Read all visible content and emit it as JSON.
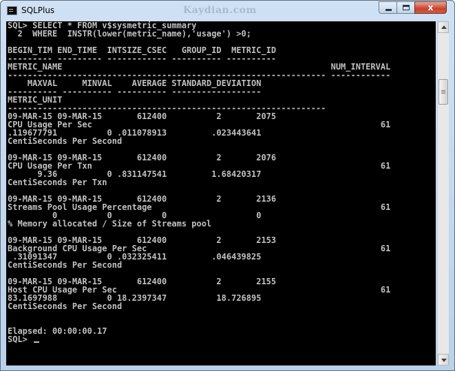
{
  "window": {
    "title": "SQLPlus",
    "watermark": "Kaydian.com"
  },
  "icons": {
    "app": "sqlplus-console-icon",
    "minimize": "minimize-icon",
    "maximize": "maximize-icon",
    "close": "close-icon"
  },
  "controls": {
    "close_glyph": "x"
  },
  "console": {
    "lines": [
      "SQL> SELECT * FROM v$sysmetric_summary",
      "  2  WHERE  INSTR(lower(metric_name),'usage') >0;",
      "",
      "BEGIN_TIM END_TIME  INTSIZE_CSEC   GROUP_ID  METRIC_ID",
      "--------- --------- ------------ ---------- ----------",
      "METRIC_NAME                                                      NUM_INTERVAL",
      "---------------------------------------------------------------- ------------",
      "    MAXVAL     MINVAL    AVERAGE STANDARD_DEVIATION",
      "---------- ---------- ---------- ------------------",
      "METRIC_UNIT",
      "----------------------------------------------------------------",
      "09-MAR-15 09-MAR-15       612400          2       2075",
      "CPU Usage Per Sec                                                          61",
      ".119677791          0 .011078913         .023443641",
      "CentiSeconds Per Second",
      "",
      "09-MAR-15 09-MAR-15       612400          2       2076",
      "CPU Usage Per Txn                                                          61",
      "      9.36          0 .831147541         1.68420317",
      "CentiSeconds Per Txn",
      "",
      "09-MAR-15 09-MAR-15       612400          2       2136",
      "Streams Pool Usage Percentage                                              61",
      "         0          0          0                  0",
      "% Memory allocated / Size of Streams pool",
      "",
      "09-MAR-15 09-MAR-15       612400          2       2153",
      "Background CPU Usage Per Sec                                               61",
      " .31091347          0 .032325411         .046439825",
      "CentiSeconds Per Second",
      "",
      "09-MAR-15 09-MAR-15       612400          2       2155",
      "Host CPU Usage Per Sec                                                     61",
      "83.1697988          0 18.2397347          18.726895",
      "CentiSeconds Per Second",
      "",
      "",
      "Elapsed: 00:00:00.17"
    ],
    "prompt": "SQL> "
  }
}
